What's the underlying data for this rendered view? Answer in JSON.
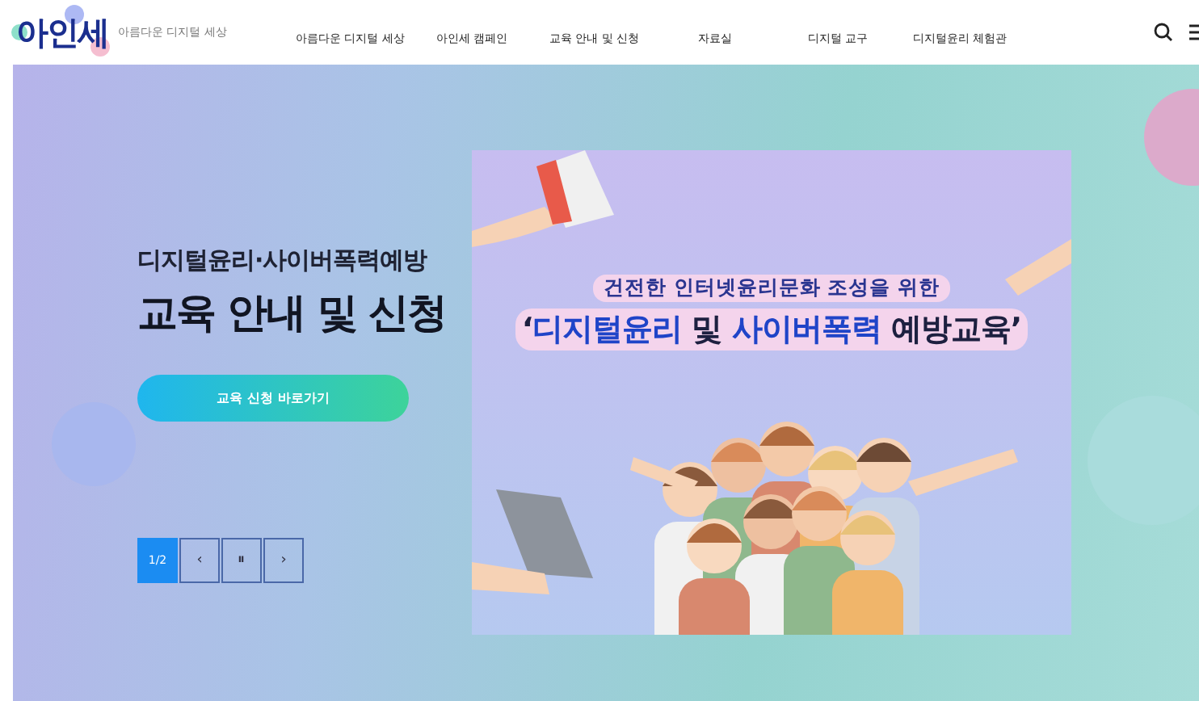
{
  "header": {
    "logo": "아인세",
    "tagline": "아름다운 디지털 세상",
    "nav": [
      {
        "label": "아름다운 디지털 세상"
      },
      {
        "label": "아인세 캠페인"
      },
      {
        "label": "교육 안내 및 신청"
      },
      {
        "label": "자료실"
      },
      {
        "label": "디지털 교구"
      },
      {
        "label": "디지털윤리 체험관"
      }
    ]
  },
  "hero": {
    "subtitle": "디지털윤리·사이버폭력예방",
    "title": "교육 안내 및 신청",
    "button": "교육 신청 바로가기",
    "pager": {
      "counter": "1/2",
      "prev": "‹",
      "pause": "⏸",
      "next": "›"
    },
    "banner": {
      "kind": "picture",
      "line1": "건전한 인터넷윤리문화 조성을 위한",
      "line2": [
        {
          "text": "‘",
          "kind": "plain"
        },
        {
          "text": "디지털윤리",
          "kind": "highlight"
        },
        {
          "text": " 및 ",
          "kind": "plain"
        },
        {
          "text": "사이버폭력",
          "kind": "highlight"
        },
        {
          "text": " 예방교육’",
          "kind": "plain"
        }
      ]
    }
  }
}
